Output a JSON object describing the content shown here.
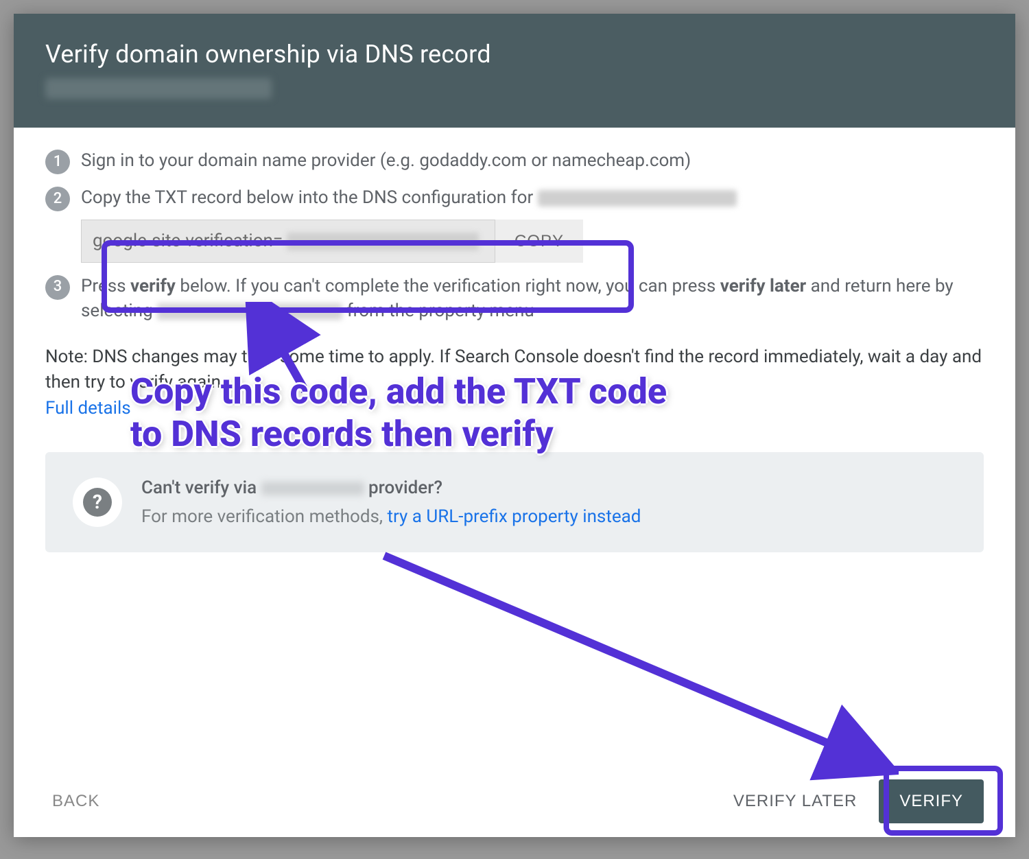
{
  "header": {
    "title": "Verify domain ownership via DNS record"
  },
  "steps": {
    "s1": {
      "num": "1",
      "text": "Sign in to your domain name provider (e.g. godaddy.com or namecheap.com)"
    },
    "s2": {
      "num": "2",
      "text_before": "Copy the TXT record below into the DNS configuration for "
    },
    "s3": {
      "num": "3",
      "press": "Press ",
      "verify": "verify",
      "mid1": " below. If you can't complete the verification right now, you can press ",
      "verify_later": "verify later",
      "mid2": " and return here by selecting ",
      "tail": " from the property menu"
    }
  },
  "txt": {
    "code_prefix": "google-site-verification=",
    "copy_label": "COPY"
  },
  "note": {
    "line": "Note: DNS changes may take some time to apply. If Search Console doesn't find the record immediately, wait a day and then try to verify again",
    "full_details": "Full details"
  },
  "hint": {
    "question_before": "Can't verify via ",
    "question_after": " provider?",
    "answer_before": "For more verification methods, ",
    "answer_link": "try a URL-prefix property instead"
  },
  "footer": {
    "back": "BACK",
    "verify_later": "VERIFY LATER",
    "verify": "VERIFY"
  },
  "annotation": {
    "callout": "Copy this code, add the TXT code to DNS records then verify"
  }
}
